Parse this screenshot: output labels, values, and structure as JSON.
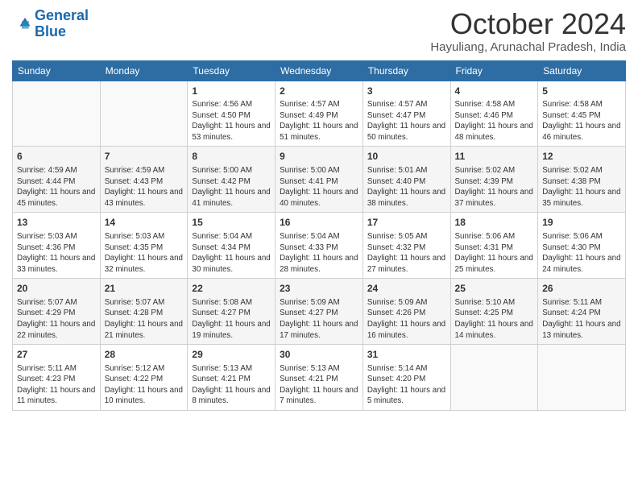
{
  "logo": {
    "line1": "General",
    "line2": "Blue"
  },
  "title": "October 2024",
  "location": "Hayuliang, Arunachal Pradesh, India",
  "days_of_week": [
    "Sunday",
    "Monday",
    "Tuesday",
    "Wednesday",
    "Thursday",
    "Friday",
    "Saturday"
  ],
  "weeks": [
    [
      {
        "day": "",
        "info": ""
      },
      {
        "day": "",
        "info": ""
      },
      {
        "day": "1",
        "info": "Sunrise: 4:56 AM\nSunset: 4:50 PM\nDaylight: 11 hours and 53 minutes."
      },
      {
        "day": "2",
        "info": "Sunrise: 4:57 AM\nSunset: 4:49 PM\nDaylight: 11 hours and 51 minutes."
      },
      {
        "day": "3",
        "info": "Sunrise: 4:57 AM\nSunset: 4:47 PM\nDaylight: 11 hours and 50 minutes."
      },
      {
        "day": "4",
        "info": "Sunrise: 4:58 AM\nSunset: 4:46 PM\nDaylight: 11 hours and 48 minutes."
      },
      {
        "day": "5",
        "info": "Sunrise: 4:58 AM\nSunset: 4:45 PM\nDaylight: 11 hours and 46 minutes."
      }
    ],
    [
      {
        "day": "6",
        "info": "Sunrise: 4:59 AM\nSunset: 4:44 PM\nDaylight: 11 hours and 45 minutes."
      },
      {
        "day": "7",
        "info": "Sunrise: 4:59 AM\nSunset: 4:43 PM\nDaylight: 11 hours and 43 minutes."
      },
      {
        "day": "8",
        "info": "Sunrise: 5:00 AM\nSunset: 4:42 PM\nDaylight: 11 hours and 41 minutes."
      },
      {
        "day": "9",
        "info": "Sunrise: 5:00 AM\nSunset: 4:41 PM\nDaylight: 11 hours and 40 minutes."
      },
      {
        "day": "10",
        "info": "Sunrise: 5:01 AM\nSunset: 4:40 PM\nDaylight: 11 hours and 38 minutes."
      },
      {
        "day": "11",
        "info": "Sunrise: 5:02 AM\nSunset: 4:39 PM\nDaylight: 11 hours and 37 minutes."
      },
      {
        "day": "12",
        "info": "Sunrise: 5:02 AM\nSunset: 4:38 PM\nDaylight: 11 hours and 35 minutes."
      }
    ],
    [
      {
        "day": "13",
        "info": "Sunrise: 5:03 AM\nSunset: 4:36 PM\nDaylight: 11 hours and 33 minutes."
      },
      {
        "day": "14",
        "info": "Sunrise: 5:03 AM\nSunset: 4:35 PM\nDaylight: 11 hours and 32 minutes."
      },
      {
        "day": "15",
        "info": "Sunrise: 5:04 AM\nSunset: 4:34 PM\nDaylight: 11 hours and 30 minutes."
      },
      {
        "day": "16",
        "info": "Sunrise: 5:04 AM\nSunset: 4:33 PM\nDaylight: 11 hours and 28 minutes."
      },
      {
        "day": "17",
        "info": "Sunrise: 5:05 AM\nSunset: 4:32 PM\nDaylight: 11 hours and 27 minutes."
      },
      {
        "day": "18",
        "info": "Sunrise: 5:06 AM\nSunset: 4:31 PM\nDaylight: 11 hours and 25 minutes."
      },
      {
        "day": "19",
        "info": "Sunrise: 5:06 AM\nSunset: 4:30 PM\nDaylight: 11 hours and 24 minutes."
      }
    ],
    [
      {
        "day": "20",
        "info": "Sunrise: 5:07 AM\nSunset: 4:29 PM\nDaylight: 11 hours and 22 minutes."
      },
      {
        "day": "21",
        "info": "Sunrise: 5:07 AM\nSunset: 4:28 PM\nDaylight: 11 hours and 21 minutes."
      },
      {
        "day": "22",
        "info": "Sunrise: 5:08 AM\nSunset: 4:27 PM\nDaylight: 11 hours and 19 minutes."
      },
      {
        "day": "23",
        "info": "Sunrise: 5:09 AM\nSunset: 4:27 PM\nDaylight: 11 hours and 17 minutes."
      },
      {
        "day": "24",
        "info": "Sunrise: 5:09 AM\nSunset: 4:26 PM\nDaylight: 11 hours and 16 minutes."
      },
      {
        "day": "25",
        "info": "Sunrise: 5:10 AM\nSunset: 4:25 PM\nDaylight: 11 hours and 14 minutes."
      },
      {
        "day": "26",
        "info": "Sunrise: 5:11 AM\nSunset: 4:24 PM\nDaylight: 11 hours and 13 minutes."
      }
    ],
    [
      {
        "day": "27",
        "info": "Sunrise: 5:11 AM\nSunset: 4:23 PM\nDaylight: 11 hours and 11 minutes."
      },
      {
        "day": "28",
        "info": "Sunrise: 5:12 AM\nSunset: 4:22 PM\nDaylight: 11 hours and 10 minutes."
      },
      {
        "day": "29",
        "info": "Sunrise: 5:13 AM\nSunset: 4:21 PM\nDaylight: 11 hours and 8 minutes."
      },
      {
        "day": "30",
        "info": "Sunrise: 5:13 AM\nSunset: 4:21 PM\nDaylight: 11 hours and 7 minutes."
      },
      {
        "day": "31",
        "info": "Sunrise: 5:14 AM\nSunset: 4:20 PM\nDaylight: 11 hours and 5 minutes."
      },
      {
        "day": "",
        "info": ""
      },
      {
        "day": "",
        "info": ""
      }
    ]
  ]
}
